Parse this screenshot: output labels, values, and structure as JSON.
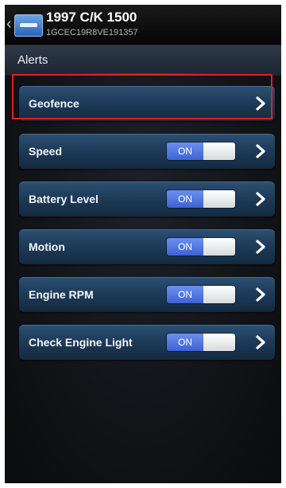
{
  "header": {
    "title": "1997 C/K 1500",
    "vin": "1GCEC19R8VE191357"
  },
  "section": {
    "title": "Alerts"
  },
  "alerts": [
    {
      "label": "Geofence",
      "toggle": null
    },
    {
      "label": "Speed",
      "toggle": "ON"
    },
    {
      "label": "Battery Level",
      "toggle": "ON"
    },
    {
      "label": "Motion",
      "toggle": "ON"
    },
    {
      "label": "Engine RPM",
      "toggle": "ON"
    },
    {
      "label": "Check Engine Light",
      "toggle": "ON"
    }
  ],
  "icons": {
    "back": "chevron-left-icon",
    "vehicle": "vehicle-icon",
    "row_arrow": "chevron-right-icon"
  },
  "colors": {
    "row_top": "#2c4f72",
    "row_bottom": "#14293f",
    "toggle_on": "#4a6fe0",
    "highlight": "#e02020"
  }
}
